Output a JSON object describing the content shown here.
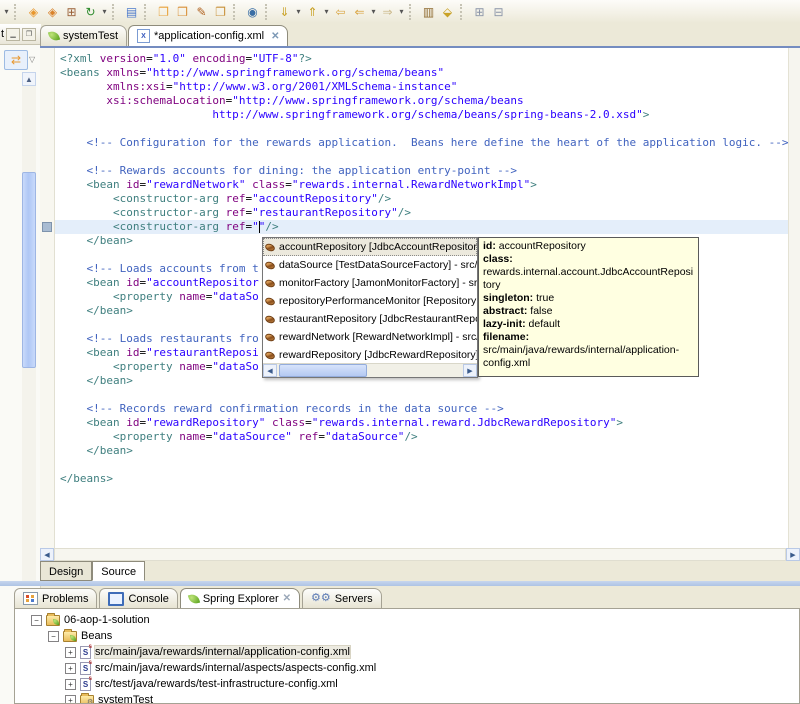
{
  "colors": {
    "desktop_bg": "#ECE9D8",
    "tab_underline_blue": "#748CC0",
    "current_line_highlight": "#E4EEFA",
    "tooltip_bg": "#FFFFE1",
    "syntax_tag": "#3F7F7F",
    "syntax_attr": "#7F007F",
    "syntax_value": "#2A00FF",
    "syntax_comment": "#4163BF"
  },
  "toolbar": {
    "items": [
      {
        "type": "caret",
        "name": "toolbar-overflow-caret"
      },
      {
        "type": "sep"
      },
      {
        "type": "icon",
        "name": "new-wizard-icon",
        "glyph": "◈",
        "color": "#E8972E"
      },
      {
        "type": "icon",
        "name": "new-wizard-alt-icon",
        "glyph": "◈",
        "color": "#D9822B"
      },
      {
        "type": "icon",
        "name": "package-icon",
        "glyph": "⊞",
        "color": "#9A6038"
      },
      {
        "type": "icon",
        "name": "refresh-icon",
        "glyph": "↻",
        "color": "#2E8B2E"
      },
      {
        "type": "caret",
        "name": "refresh-caret"
      },
      {
        "type": "sep"
      },
      {
        "type": "icon",
        "name": "outline-view-icon",
        "glyph": "▤",
        "color": "#4C7ACC"
      },
      {
        "type": "sep"
      },
      {
        "type": "icon",
        "name": "open-resource-icon",
        "glyph": "❐",
        "color": "#E8A33D"
      },
      {
        "type": "icon",
        "name": "open-type-icon",
        "glyph": "❒",
        "color": "#D9913A"
      },
      {
        "type": "icon",
        "name": "search-brush-icon",
        "glyph": "✎",
        "color": "#B0621F"
      },
      {
        "type": "icon",
        "name": "open-folder-icon",
        "glyph": "❐",
        "color": "#C8913A"
      },
      {
        "type": "sep"
      },
      {
        "type": "icon",
        "name": "web-browser-icon",
        "glyph": "◉",
        "color": "#3A6EA5"
      },
      {
        "type": "sep"
      },
      {
        "type": "icon",
        "name": "next-annotation-icon",
        "glyph": "⇓",
        "color": "#C9A227"
      },
      {
        "type": "caret",
        "name": "next-annotation-caret"
      },
      {
        "type": "icon",
        "name": "prev-annotation-icon",
        "glyph": "⇑",
        "color": "#C9A227"
      },
      {
        "type": "caret",
        "name": "prev-annotation-caret"
      },
      {
        "type": "icon",
        "name": "last-edit-icon",
        "glyph": "⇦",
        "color": "#D9A441"
      },
      {
        "type": "icon",
        "name": "back-icon",
        "glyph": "⇐",
        "color": "#D9A441"
      },
      {
        "type": "caret",
        "name": "back-caret"
      },
      {
        "type": "icon",
        "name": "forward-icon",
        "glyph": "⇒",
        "color": "#CBB98A"
      },
      {
        "type": "caret",
        "name": "forward-caret"
      },
      {
        "type": "sep"
      },
      {
        "type": "icon",
        "name": "jar-icon",
        "glyph": "▥",
        "color": "#8E6A2F"
      },
      {
        "type": "icon",
        "name": "tag-icon",
        "glyph": "⬙",
        "color": "#C9A227"
      },
      {
        "type": "sep"
      },
      {
        "type": "icon",
        "name": "expand-all-icon",
        "glyph": "⊞",
        "color": "#8A94A8"
      },
      {
        "type": "icon",
        "name": "collapse-all-icon",
        "glyph": "⊟",
        "color": "#8A94A8"
      }
    ]
  },
  "left_panel": {
    "title_fragment": "t",
    "minimize_glyph": "▁",
    "maximize_glyph": "❐",
    "link_with_editor_glyph": "⇄",
    "view_menu_caret": "▽",
    "scroll_up_glyph": "▲"
  },
  "editor_tabs": [
    {
      "label": "systemTest",
      "icon": "spring-leaf-icon",
      "active": false,
      "closable": false
    },
    {
      "label": "*application-config.xml",
      "icon": "xml-file-icon",
      "active": true,
      "closable": true,
      "close_glyph": "✕"
    }
  ],
  "code": {
    "cursor_line": 12,
    "cursor_col": 30,
    "lines": [
      [
        [
          "t",
          "<?xml "
        ],
        [
          "a",
          "version"
        ],
        [
          "p",
          "="
        ],
        [
          "v",
          "\"1.0\""
        ],
        [
          "p",
          " "
        ],
        [
          "a",
          "encoding"
        ],
        [
          "p",
          "="
        ],
        [
          "v",
          "\"UTF-8\""
        ],
        [
          "t",
          "?>"
        ]
      ],
      [
        [
          "t",
          "<beans "
        ],
        [
          "a",
          "xmlns"
        ],
        [
          "p",
          "="
        ],
        [
          "v",
          "\"http://www.springframework.org/schema/beans\""
        ]
      ],
      [
        [
          "p",
          "       "
        ],
        [
          "a",
          "xmlns:xsi"
        ],
        [
          "p",
          "="
        ],
        [
          "v",
          "\"http://www.w3.org/2001/XMLSchema-instance\""
        ]
      ],
      [
        [
          "p",
          "       "
        ],
        [
          "a",
          "xsi:schemaLocation"
        ],
        [
          "p",
          "="
        ],
        [
          "v",
          "\"http://www.springframework.org/schema/beans"
        ]
      ],
      [
        [
          "v",
          "                       http://www.springframework.org/schema/beans/spring-beans-2.0.xsd\""
        ],
        [
          "t",
          ">"
        ]
      ],
      [],
      [
        [
          "p",
          "    "
        ],
        [
          "c",
          "<!-- Configuration for the rewards application.  Beans here define the heart of the application logic. -->"
        ]
      ],
      [],
      [
        [
          "p",
          "    "
        ],
        [
          "c",
          "<!-- Rewards accounts for dining: the application entry-point -->"
        ]
      ],
      [
        [
          "p",
          "    "
        ],
        [
          "t",
          "<bean "
        ],
        [
          "a",
          "id"
        ],
        [
          "p",
          "="
        ],
        [
          "v",
          "\"rewardNetwork\""
        ],
        [
          "p",
          " "
        ],
        [
          "a",
          "class"
        ],
        [
          "p",
          "="
        ],
        [
          "v",
          "\"rewards.internal.RewardNetworkImpl\""
        ],
        [
          "t",
          ">"
        ]
      ],
      [
        [
          "p",
          "        "
        ],
        [
          "t",
          "<constructor-arg "
        ],
        [
          "a",
          "ref"
        ],
        [
          "p",
          "="
        ],
        [
          "v",
          "\"accountRepository\""
        ],
        [
          "t",
          "/>"
        ]
      ],
      [
        [
          "p",
          "        "
        ],
        [
          "t",
          "<constructor-arg "
        ],
        [
          "a",
          "ref"
        ],
        [
          "p",
          "="
        ],
        [
          "v",
          "\"restaurantRepository\""
        ],
        [
          "t",
          "/>"
        ]
      ],
      [
        [
          "p",
          "        "
        ],
        [
          "t",
          "<constructor-arg "
        ],
        [
          "a",
          "ref"
        ],
        [
          "p",
          "="
        ],
        [
          "v",
          "\"\""
        ],
        [
          "t",
          "/>"
        ]
      ],
      [
        [
          "p",
          "    "
        ],
        [
          "t",
          "</bean>"
        ]
      ],
      [],
      [
        [
          "p",
          "    "
        ],
        [
          "c",
          "<!-- Loads accounts from t"
        ]
      ],
      [
        [
          "p",
          "    "
        ],
        [
          "t",
          "<bean "
        ],
        [
          "a",
          "id"
        ],
        [
          "p",
          "="
        ],
        [
          "v",
          "\"accountRepositor"
        ]
      ],
      [
        [
          "p",
          "        "
        ],
        [
          "t",
          "<property "
        ],
        [
          "a",
          "name"
        ],
        [
          "p",
          "="
        ],
        [
          "v",
          "\"dataSo"
        ]
      ],
      [
        [
          "p",
          "    "
        ],
        [
          "t",
          "</bean>"
        ]
      ],
      [],
      [
        [
          "p",
          "    "
        ],
        [
          "c",
          "<!-- Loads restaurants fro"
        ]
      ],
      [
        [
          "p",
          "    "
        ],
        [
          "t",
          "<bean "
        ],
        [
          "a",
          "id"
        ],
        [
          "p",
          "="
        ],
        [
          "v",
          "\"restaurantReposi"
        ]
      ],
      [
        [
          "p",
          "        "
        ],
        [
          "t",
          "<property "
        ],
        [
          "a",
          "name"
        ],
        [
          "p",
          "="
        ],
        [
          "v",
          "\"dataSo"
        ]
      ],
      [
        [
          "p",
          "    "
        ],
        [
          "t",
          "</bean>"
        ]
      ],
      [],
      [
        [
          "p",
          "    "
        ],
        [
          "c",
          "<!-- Records reward confirmation records in the data source -->"
        ]
      ],
      [
        [
          "p",
          "    "
        ],
        [
          "t",
          "<bean "
        ],
        [
          "a",
          "id"
        ],
        [
          "p",
          "="
        ],
        [
          "v",
          "\"rewardRepository\""
        ],
        [
          "p",
          " "
        ],
        [
          "a",
          "class"
        ],
        [
          "p",
          "="
        ],
        [
          "v",
          "\"rewards.internal.reward.JdbcRewardRepository\""
        ],
        [
          "t",
          ">"
        ]
      ],
      [
        [
          "p",
          "        "
        ],
        [
          "t",
          "<property "
        ],
        [
          "a",
          "name"
        ],
        [
          "p",
          "="
        ],
        [
          "v",
          "\"dataSource\""
        ],
        [
          "p",
          " "
        ],
        [
          "a",
          "ref"
        ],
        [
          "p",
          "="
        ],
        [
          "v",
          "\"dataSource\""
        ],
        [
          "t",
          "/>"
        ]
      ],
      [
        [
          "p",
          "    "
        ],
        [
          "t",
          "</bean>"
        ]
      ],
      [],
      [
        [
          "t",
          "</beans>"
        ]
      ]
    ]
  },
  "completion_popup": {
    "items": [
      {
        "label": "accountRepository [JdbcAccountRepository] - src/",
        "selected": true
      },
      {
        "label": "dataSource [TestDataSourceFactory] - src/test/ja",
        "selected": false
      },
      {
        "label": "monitorFactory [JamonMonitorFactory] - src/main",
        "selected": false
      },
      {
        "label": "repositoryPerformanceMonitor [RepositoryPerform",
        "selected": false
      },
      {
        "label": "restaurantRepository [JdbcRestaurantRepository]",
        "selected": false
      },
      {
        "label": "rewardNetwork [RewardNetworkImpl] - src/main/j",
        "selected": false
      },
      {
        "label": "rewardRepository [JdbcRewardRepository] - src/r",
        "selected": false
      }
    ],
    "scroll_left_glyph": "◀",
    "scroll_right_glyph": "▶"
  },
  "bean_tooltip": {
    "fields": [
      {
        "label": "id:",
        "value": " accountRepository"
      },
      {
        "label": "class:",
        "value": " rewards.internal.account.JdbcAccountRepository"
      },
      {
        "label": "singleton:",
        "value": " true"
      },
      {
        "label": "abstract:",
        "value": " false"
      },
      {
        "label": "lazy-init:",
        "value": " default"
      },
      {
        "label": "filename:",
        "value": " src/main/java/rewards/internal/application-config.xml"
      }
    ]
  },
  "editor_hscroll": {
    "left_glyph": "◀",
    "right_glyph": "▶"
  },
  "page_tabs": [
    {
      "label": "Design",
      "active": false
    },
    {
      "label": "Source",
      "active": true
    }
  ],
  "bottom_tabs": [
    {
      "label": "Problems",
      "icon": "problems-icon",
      "active": false,
      "closable": false
    },
    {
      "label": "Console",
      "icon": "console-icon",
      "active": false,
      "closable": false
    },
    {
      "label": "Spring Explorer",
      "icon": "spring-leaf-icon",
      "active": true,
      "closable": true,
      "close_glyph": "✕"
    },
    {
      "label": "Servers",
      "icon": "servers-icon",
      "active": false,
      "closable": false
    }
  ],
  "explorer_tree": {
    "rows": [
      {
        "level": 0,
        "expander": "-",
        "icon": "spring-project-icon",
        "label": "06-aop-1-solution",
        "selected": false
      },
      {
        "level": 1,
        "expander": "-",
        "icon": "beans-folder-icon",
        "label": "Beans",
        "selected": false
      },
      {
        "level": 2,
        "expander": "+",
        "icon": "spring-config-icon",
        "label": "src/main/java/rewards/internal/application-config.xml",
        "selected": true
      },
      {
        "level": 2,
        "expander": "+",
        "icon": "spring-config-icon",
        "label": "src/main/java/rewards/internal/aspects/aspects-config.xml",
        "selected": false
      },
      {
        "level": 2,
        "expander": "+",
        "icon": "spring-config-icon",
        "label": "src/test/java/rewards/test-infrastructure-config.xml",
        "selected": false
      },
      {
        "level": 2,
        "expander": "+",
        "icon": "config-set-icon",
        "label": "systemTest",
        "selected": false
      }
    ]
  }
}
